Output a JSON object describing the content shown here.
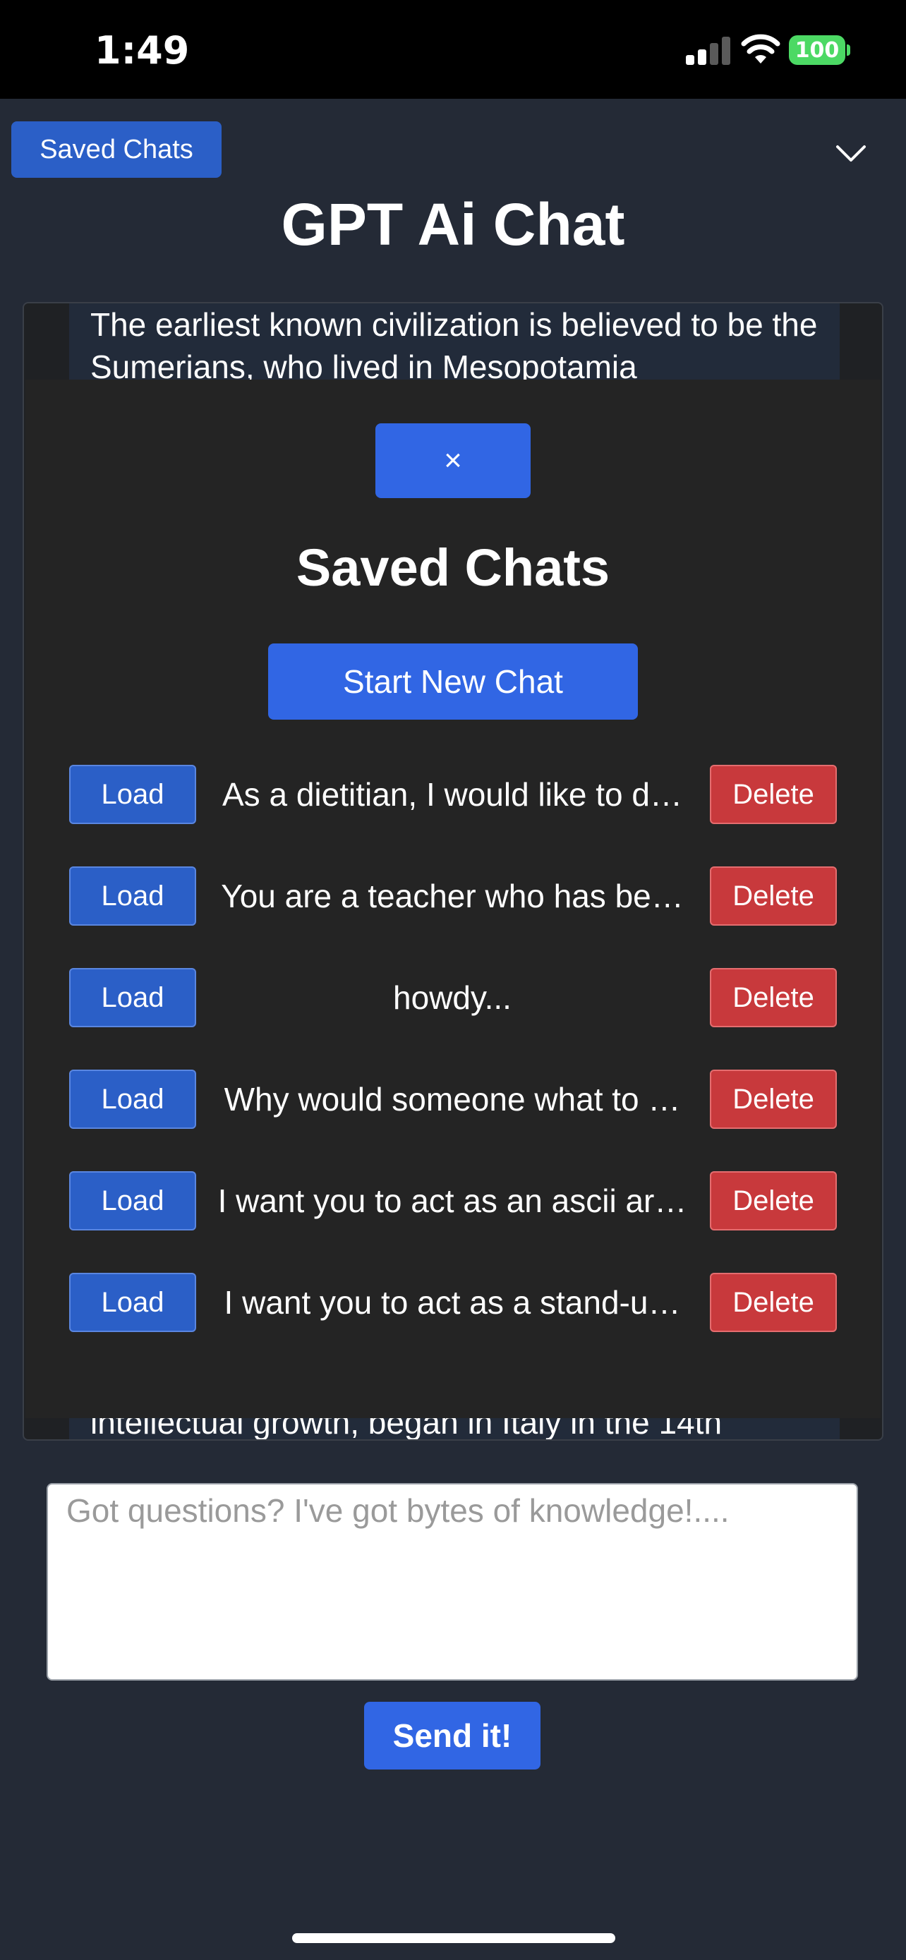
{
  "status_bar": {
    "time": "1:49",
    "battery": "100",
    "signal_icon": "cellular-signal-icon",
    "wifi_icon": "wifi-icon"
  },
  "header": {
    "saved_chats_button": "Saved Chats",
    "title": "GPT Ai Chat",
    "menu_icon": "chevron-down-icon"
  },
  "chat_log": {
    "top_message": "The earliest known civilization is believed to be the Sumerians, who lived in Mesopotamia",
    "bottom_message": "intellectual growth, began in Italy in the 14th"
  },
  "modal": {
    "close_label": "×",
    "title": "Saved Chats",
    "new_chat_label": "Start New Chat",
    "load_label": "Load",
    "delete_label": "Delete",
    "chats": [
      {
        "title": "As a dietitian, I would like to d…"
      },
      {
        "title": "You are a teacher who has be…"
      },
      {
        "title": "howdy..."
      },
      {
        "title": "Why would someone what to …"
      },
      {
        "title": "I want you to act as an ascii ar…"
      },
      {
        "title": "I want you to act as a stand-u…"
      }
    ]
  },
  "input": {
    "placeholder": "Got questions? I've got bytes of knowledge!....",
    "value": ""
  },
  "send_button": "Send it!",
  "colors": {
    "background": "#242a36",
    "primary": "#3166e4",
    "load": "#2b5fc7",
    "danger": "#c8393c",
    "modal": "#242424",
    "battery": "#4cd964"
  }
}
